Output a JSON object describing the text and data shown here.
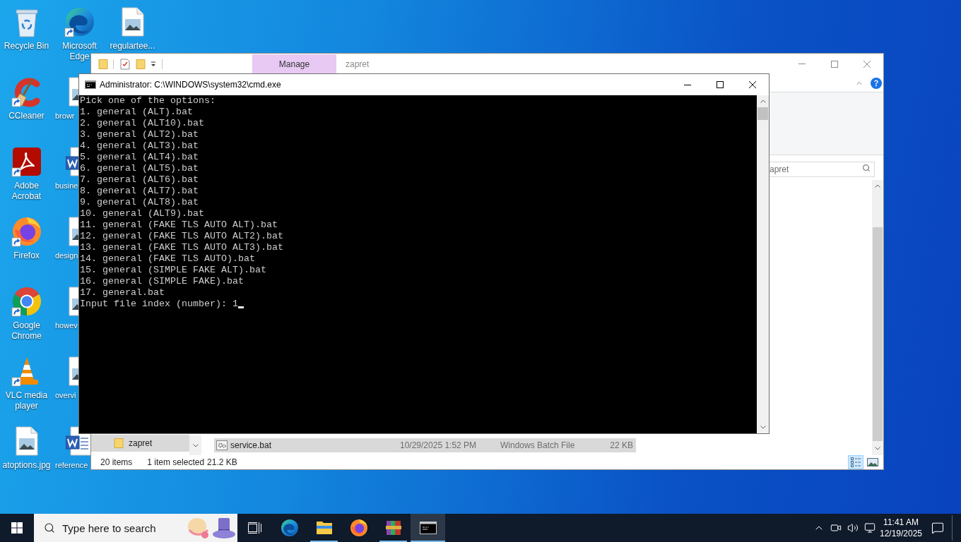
{
  "desktop": {
    "columns": [
      {
        "icons": [
          {
            "label": "Recycle Bin",
            "kind": "recycle-bin",
            "shortcut": false
          },
          {
            "label": "CCleaner",
            "kind": "cleaner",
            "shortcut": true
          },
          {
            "label": "Adobe Acrobat",
            "kind": "pdf",
            "shortcut": true
          },
          {
            "label": "Firefox",
            "kind": "firefox",
            "shortcut": true
          },
          {
            "label": "Google Chrome",
            "kind": "chrome",
            "shortcut": true
          },
          {
            "label": "VLC media player",
            "kind": "vlc",
            "shortcut": true
          },
          {
            "label": "atoptions.jpg",
            "kind": "image",
            "shortcut": false
          }
        ]
      },
      {
        "icons": [
          {
            "label": "Microsoft Edge",
            "kind": "edge",
            "shortcut": true
          },
          {
            "label": "browr",
            "kind": "image",
            "shortcut": false
          },
          {
            "label": "busine",
            "kind": "word",
            "shortcut": false
          },
          {
            "label": "design",
            "kind": "image",
            "shortcut": false
          },
          {
            "label": "howev",
            "kind": "image",
            "shortcut": false
          },
          {
            "label": "overvi",
            "kind": "image",
            "shortcut": false
          },
          {
            "label": "reference",
            "kind": "word",
            "shortcut": false
          }
        ]
      },
      {
        "icons": [
          {
            "label": "regulartee...",
            "kind": "image",
            "shortcut": false
          }
        ]
      }
    ]
  },
  "explorer": {
    "context_tab": "Manage",
    "title": "zapret",
    "search": {
      "placeholder": "apret"
    },
    "nav_items": [
      {
        "label": "zapret",
        "selected": true
      }
    ],
    "files": [
      {
        "name": "service.bat",
        "date_modified": "10/29/2025 1:52 PM",
        "type": "Windows Batch File",
        "size": "22 KB",
        "selected": true
      }
    ],
    "status_bar": {
      "item_count": "20 items",
      "selection": "1 item selected",
      "selection_size": "21.2 KB"
    },
    "view_buttons": [
      {
        "kind": "details",
        "selected": true
      },
      {
        "kind": "large-icons",
        "selected": false
      }
    ]
  },
  "cmd_window": {
    "title": "Administrator: C:\\WINDOWS\\system32\\cmd.exe",
    "lines": [
      "Pick one of the options:",
      "1. general (ALT).bat",
      "2. general (ALT10).bat",
      "3. general (ALT2).bat",
      "4. general (ALT3).bat",
      "5. general (ALT4).bat",
      "6. general (ALT5).bat",
      "7. general (ALT6).bat",
      "8. general (ALT7).bat",
      "9. general (ALT8).bat",
      "10. general (ALT9).bat",
      "11. general (FAKE TLS AUTO ALT).bat",
      "12. general (FAKE TLS AUTO ALT2).bat",
      "13. general (FAKE TLS AUTO ALT3).bat",
      "14. general (FAKE TLS AUTO).bat",
      "15. general (SIMPLE FAKE ALT).bat",
      "16. general (SIMPLE FAKE).bat",
      "17. general.bat"
    ],
    "input_line": "Input file index (number): 1"
  },
  "taskbar": {
    "search": {
      "placeholder": "Type here to search"
    },
    "apps": [
      {
        "kind": "edge",
        "running": false,
        "active": false
      },
      {
        "kind": "explorer",
        "running": true,
        "active": false
      },
      {
        "kind": "firefox",
        "running": false,
        "active": false
      },
      {
        "kind": "winrar",
        "running": true,
        "active": false
      },
      {
        "kind": "cmd",
        "running": true,
        "active": true
      }
    ],
    "clock": {
      "time": "11:41 AM",
      "date": "12/19/2025"
    }
  }
}
